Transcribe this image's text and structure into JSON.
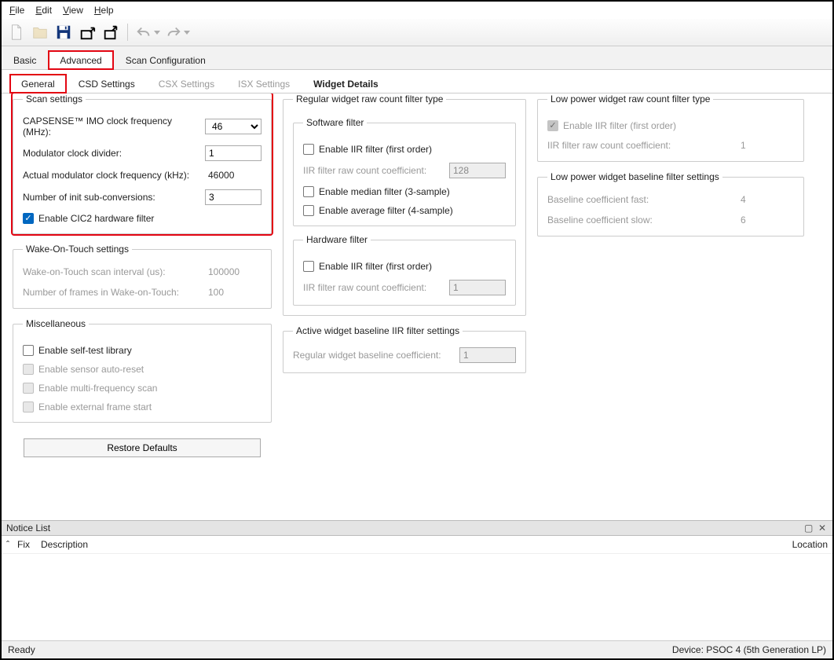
{
  "menu": {
    "file": "File",
    "edit": "Edit",
    "view": "View",
    "help": "Help"
  },
  "mainTabs": {
    "basic": "Basic",
    "advanced": "Advanced",
    "scanConfig": "Scan Configuration"
  },
  "subTabs": {
    "general": "General",
    "csd": "CSD Settings",
    "csx": "CSX Settings",
    "isx": "ISX Settings",
    "widgetDetails": "Widget Details"
  },
  "scanSettings": {
    "legend": "Scan settings",
    "imoLabel": "CAPSENSE™ IMO clock frequency (MHz):",
    "imoValue": "46",
    "modDivLabel": "Modulator clock divider:",
    "modDivValue": "1",
    "actualModLabel": "Actual modulator clock frequency (kHz):",
    "actualModValue": "46000",
    "initSubLabel": "Number of init sub-conversions:",
    "initSubValue": "3",
    "enableCic2": "Enable CIC2 hardware filter"
  },
  "wakeOnTouch": {
    "legend": "Wake-On-Touch settings",
    "scanIntervalLabel": "Wake-on-Touch scan interval (us):",
    "scanIntervalValue": "100000",
    "framesLabel": "Number of frames in Wake-on-Touch:",
    "framesValue": "100"
  },
  "misc": {
    "legend": "Miscellaneous",
    "selfTest": "Enable self-test library",
    "autoReset": "Enable sensor auto-reset",
    "multiFreq": "Enable multi-frequency scan",
    "extFrame": "Enable external frame start"
  },
  "restoreDefaults": "Restore Defaults",
  "regularRawFilter": {
    "legend": "Regular widget raw count filter type",
    "softwareLegend": "Software filter",
    "iirFirst": "Enable IIR filter (first order)",
    "iirCoeffLabel": "IIR filter raw count coefficient:",
    "iirCoeffValue": "128",
    "median": "Enable median filter (3-sample)",
    "average": "Enable average filter (4-sample)",
    "hardwareLegend": "Hardware filter",
    "hwIir": "Enable IIR filter (first order)",
    "hwCoeffLabel": "IIR filter raw count coefficient:",
    "hwCoeffValue": "1"
  },
  "activeBaseline": {
    "legend": "Active widget baseline IIR filter settings",
    "regCoeffLabel": "Regular widget baseline coefficient:",
    "regCoeffValue": "1"
  },
  "lowPowerRawFilter": {
    "legend": "Low power widget raw count filter type",
    "enableIir": "Enable IIR filter (first order)",
    "coeffLabel": "IIR filter raw count coefficient:",
    "coeffValue": "1"
  },
  "lowPowerBaseline": {
    "legend": "Low power widget baseline filter settings",
    "fastLabel": "Baseline coefficient fast:",
    "fastValue": "4",
    "slowLabel": "Baseline coefficient slow:",
    "slowValue": "6"
  },
  "notice": {
    "title": "Notice List",
    "fix": "Fix",
    "description": "Description",
    "location": "Location"
  },
  "status": {
    "ready": "Ready",
    "device": "Device: PSOC 4 (5th Generation LP)"
  }
}
